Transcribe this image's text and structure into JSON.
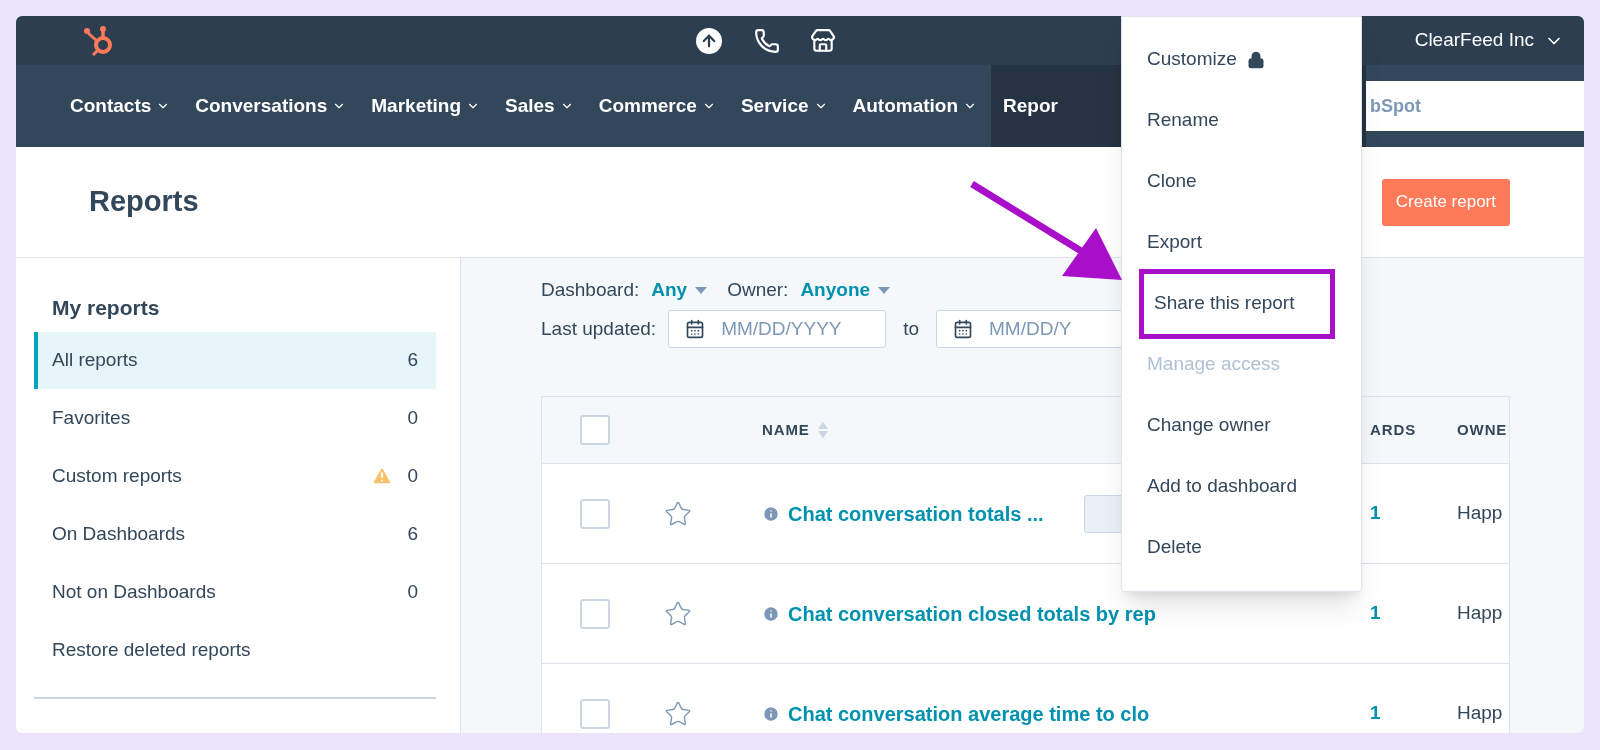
{
  "top_bar": {
    "account": "ClearFeed Inc"
  },
  "nav": {
    "items": [
      {
        "label": "Contacts",
        "selected": false
      },
      {
        "label": "Conversations",
        "selected": false
      },
      {
        "label": "Marketing",
        "selected": false
      },
      {
        "label": "Sales",
        "selected": false
      },
      {
        "label": "Commerce",
        "selected": false
      },
      {
        "label": "Service",
        "selected": false
      },
      {
        "label": "Automation",
        "selected": false
      },
      {
        "label": "Repor",
        "selected": true
      }
    ],
    "search": {
      "placeholder": "bSpot"
    }
  },
  "header": {
    "title": "Reports",
    "create_button": "Create report"
  },
  "sidebar": {
    "title": "My reports",
    "items": [
      {
        "label": "All reports",
        "count": "6",
        "selected": true,
        "warning": false
      },
      {
        "label": "Favorites",
        "count": "0",
        "selected": false,
        "warning": false
      },
      {
        "label": "Custom reports",
        "count": "0",
        "selected": false,
        "warning": true
      },
      {
        "label": "On Dashboards",
        "count": "6",
        "selected": false,
        "warning": false
      },
      {
        "label": "Not on Dashboards",
        "count": "0",
        "selected": false,
        "warning": false
      },
      {
        "label": "Restore deleted reports",
        "selected": false,
        "warning": false
      }
    ]
  },
  "filters": {
    "dashboard_label": "Dashboard:",
    "dashboard_value": "Any",
    "owner_label": "Owner:",
    "owner_value": "Anyone",
    "updated_label": "Last updated:",
    "from_placeholder": "MM/DD/YYYY",
    "to_label": "to",
    "to_placeholder": "MM/DD/Y"
  },
  "table": {
    "all_checked": false,
    "columns": [
      "NAME",
      "ARDS",
      "OWNE"
    ],
    "rows": [
      {
        "name": "Chat conversation totals ...",
        "dashboards": "1",
        "owner": "Happ",
        "checked": false,
        "starred": false,
        "has_tag": true
      },
      {
        "name": "Chat conversation closed totals by rep",
        "dashboards": "1",
        "owner": "Happ",
        "checked": false,
        "starred": false,
        "has_tag": false
      },
      {
        "name": "Chat conversation average time to clo",
        "dashboards": "1",
        "owner": "Happ",
        "checked": false,
        "starred": false,
        "has_tag": false
      }
    ]
  },
  "menu": {
    "items": [
      {
        "label": "Customize",
        "locked": true,
        "disabled": false,
        "highlighted": false
      },
      {
        "label": "Rename",
        "locked": false,
        "disabled": false,
        "highlighted": false
      },
      {
        "label": "Clone",
        "locked": false,
        "disabled": false,
        "highlighted": false
      },
      {
        "label": "Export",
        "locked": false,
        "disabled": false,
        "highlighted": false
      },
      {
        "label": "Share this report",
        "locked": false,
        "disabled": false,
        "highlighted": true
      },
      {
        "label": "Manage access",
        "locked": false,
        "disabled": true,
        "highlighted": false
      },
      {
        "label": "Change owner",
        "locked": false,
        "disabled": false,
        "highlighted": false
      },
      {
        "label": "Add to dashboard",
        "locked": false,
        "disabled": false,
        "highlighted": false
      },
      {
        "label": "Delete",
        "locked": false,
        "disabled": false,
        "highlighted": false
      }
    ]
  }
}
